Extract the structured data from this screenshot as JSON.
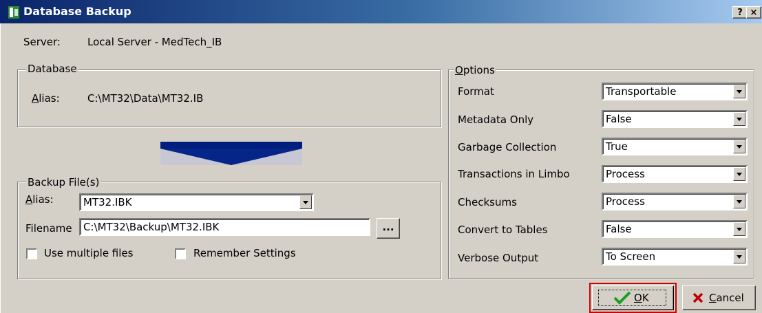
{
  "window": {
    "title": "Database Backup",
    "help_label": "?",
    "close_label": "×"
  },
  "server": {
    "label": "Server:",
    "value": "Local Server - MedTech_IB"
  },
  "database_group": {
    "legend": "Database",
    "alias_label_first": "A",
    "alias_label_rest": "lias:",
    "alias_value": "C:\\MT32\\Data\\MT32.IB"
  },
  "backup_group": {
    "legend": "Backup File(s)",
    "alias_label_first": "A",
    "alias_label_rest": "lias:",
    "alias_value": "MT32.IBK",
    "filename_label": "Filename",
    "filename_value": "C:\\MT32\\Backup\\MT32.IBK",
    "browse_label": "...",
    "multiple_files_label": "Use multiple files",
    "remember_label": "Remember Settings"
  },
  "options_group": {
    "legend_first": "O",
    "legend_rest": "ptions",
    "rows": [
      {
        "label": "Format",
        "value": "Transportable"
      },
      {
        "label": "Metadata Only",
        "value": "False"
      },
      {
        "label": "Garbage Collection",
        "value": "True"
      },
      {
        "label": "Transactions in Limbo",
        "value": "Process"
      },
      {
        "label": "Checksums",
        "value": "Process"
      },
      {
        "label": "Convert to Tables",
        "value": "False"
      },
      {
        "label": "Verbose Output",
        "value": "To Screen"
      }
    ]
  },
  "buttons": {
    "ok_first": "O",
    "ok_rest": "K",
    "cancel_first": "C",
    "cancel_rest": "ancel"
  },
  "colors": {
    "arrow": "#001e7e",
    "ok_highlight": "#d00000",
    "check": "#1c9e1c",
    "cancel_x": "#c00000"
  }
}
